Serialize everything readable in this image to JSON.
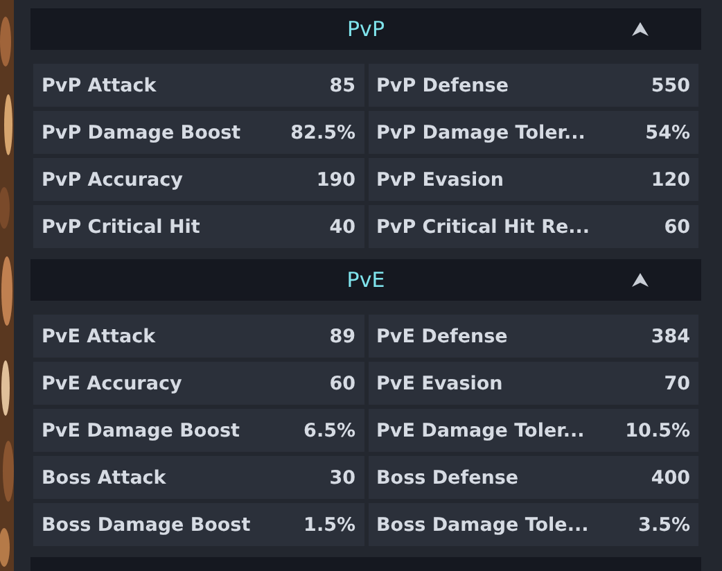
{
  "sections": [
    {
      "title": "PvP",
      "expanded": true,
      "stats": [
        {
          "label": "PvP Attack",
          "value": "85"
        },
        {
          "label": "PvP Defense",
          "value": "550"
        },
        {
          "label": "PvP Damage Boost",
          "value": "82.5%"
        },
        {
          "label": "PvP Damage Toler...",
          "value": "54%"
        },
        {
          "label": "PvP Accuracy",
          "value": "190"
        },
        {
          "label": "PvP Evasion",
          "value": "120"
        },
        {
          "label": "PvP Critical Hit",
          "value": "40"
        },
        {
          "label": "PvP Critical Hit Re...",
          "value": "60"
        }
      ]
    },
    {
      "title": "PvE",
      "expanded": true,
      "stats": [
        {
          "label": "PvE Attack",
          "value": "89"
        },
        {
          "label": "PvE Defense",
          "value": "384"
        },
        {
          "label": "PvE Accuracy",
          "value": "60"
        },
        {
          "label": "PvE Evasion",
          "value": "70"
        },
        {
          "label": "PvE Damage Boost",
          "value": "6.5%"
        },
        {
          "label": "PvE Damage Toler...",
          "value": "10.5%"
        },
        {
          "label": "Boss Attack",
          "value": "30"
        },
        {
          "label": "Boss Defense",
          "value": "400"
        },
        {
          "label": "Boss Damage Boost",
          "value": "1.5%"
        },
        {
          "label": "Boss Damage Tole...",
          "value": "3.5%"
        }
      ]
    }
  ]
}
